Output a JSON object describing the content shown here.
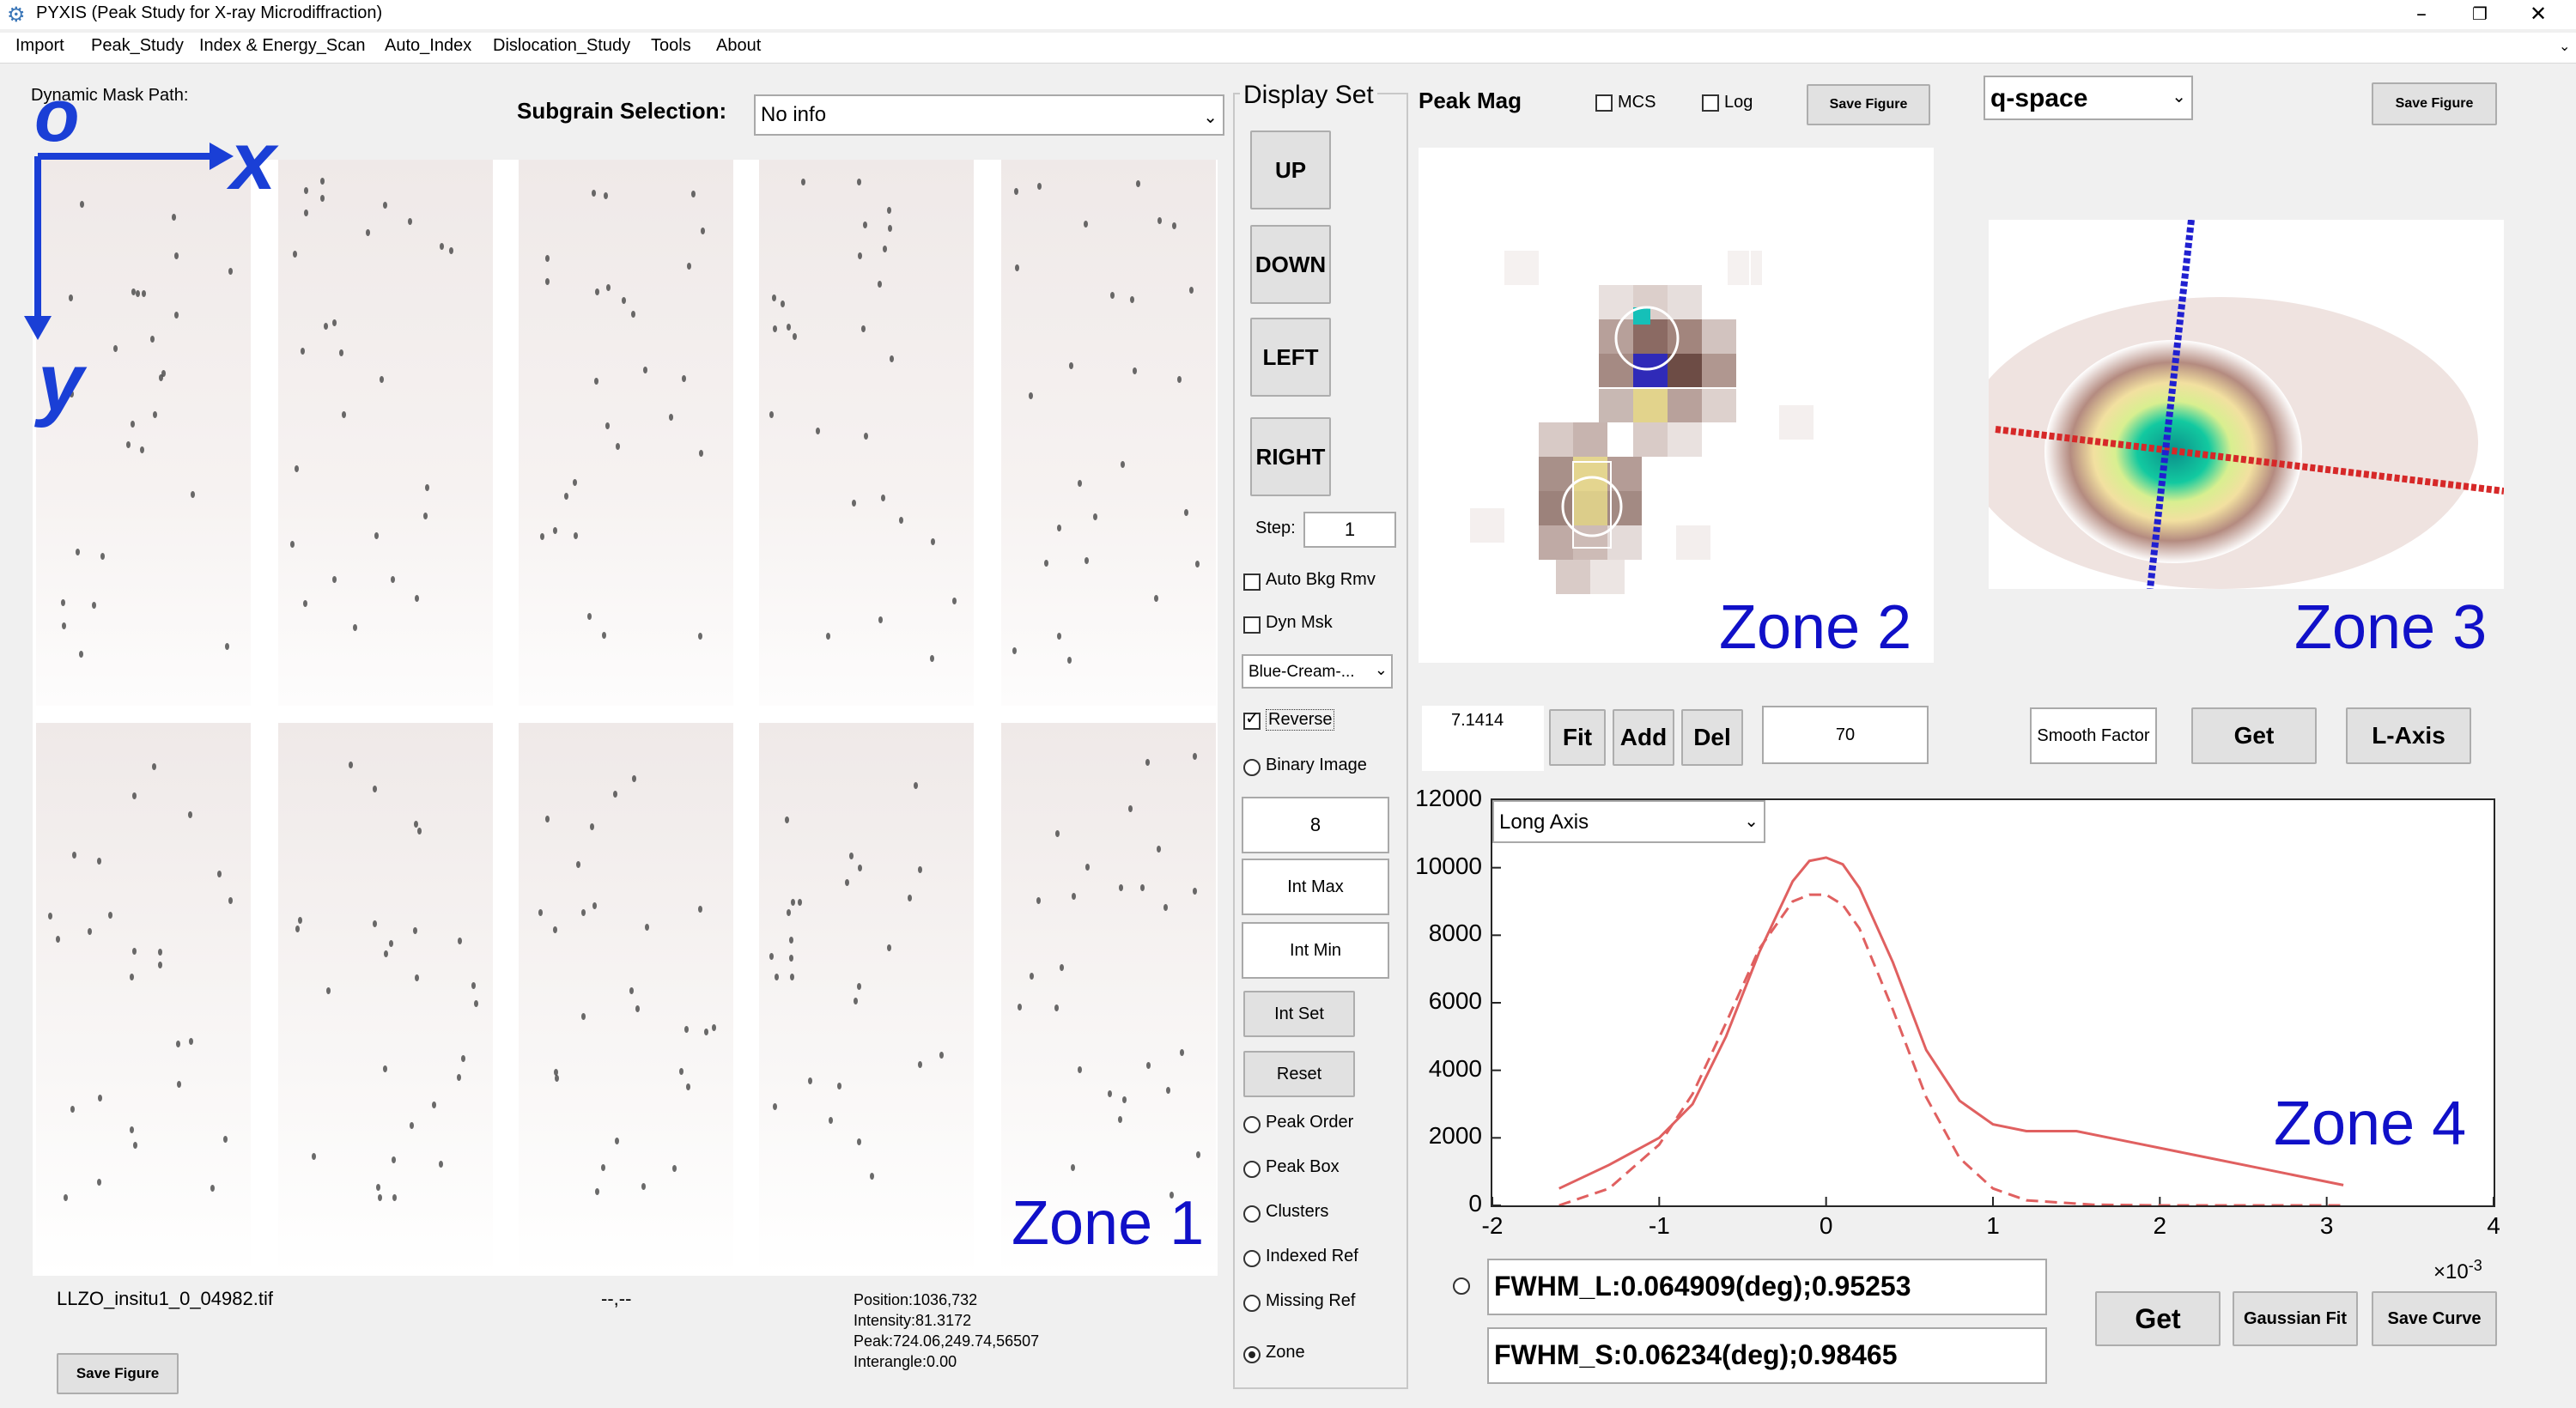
{
  "window": {
    "title": "PYXIS (Peak Study for X-ray Microdiffraction)",
    "app_icon": "gear-icon",
    "controls": [
      "–",
      "❐",
      "✕"
    ]
  },
  "menu": [
    "Import",
    "Peak_Study",
    "Index & Energy_Scan",
    "Auto_Index",
    "Dislocation_Study",
    "Tools",
    "About"
  ],
  "zone1": {
    "mask_path_label": "Dynamic Mask Path:",
    "subgrain_label": "Subgrain Selection:",
    "subgrain_value": "No info",
    "axis_origin": "o",
    "axis_x": "x",
    "axis_y": "y",
    "zone_label": "Zone 1",
    "filename": "LLZO_insitu1_0_04982.tif",
    "coords": "--,--",
    "position": "Position:1036,732",
    "intensity": "Intensity:81.3172",
    "peak": "Peak:724.06,249.74,56507",
    "interangle": "Interangle:0.00",
    "save_figure": "Save Figure"
  },
  "display_set": {
    "title": "Display Set",
    "up": "UP",
    "down": "DOWN",
    "left": "LEFT",
    "right": "RIGHT",
    "step_label": "Step:",
    "step_value": "1",
    "auto_bkg": {
      "label": "Auto Bkg Rmv",
      "checked": false
    },
    "dyn_msk": {
      "label": "Dyn Msk",
      "checked": false
    },
    "colormap": "Blue-Cream-...",
    "reverse": {
      "label": "Reverse",
      "checked": true
    },
    "binary_image": "Binary Image",
    "binary_value": "8",
    "int_max": "Int Max",
    "int_min": "Int Min",
    "int_set": "Int Set",
    "reset": "Reset",
    "radios": [
      {
        "label": "Peak Order",
        "selected": false
      },
      {
        "label": "Peak Box",
        "selected": false
      },
      {
        "label": "Clusters",
        "selected": false
      },
      {
        "label": "Indexed Ref",
        "selected": false
      },
      {
        "label": "Missing Ref",
        "selected": false
      },
      {
        "label": "Zone",
        "selected": true
      }
    ]
  },
  "zone2": {
    "title": "Peak Mag",
    "mcs": {
      "label": "MCS",
      "checked": false
    },
    "log": {
      "label": "Log",
      "checked": false
    },
    "save_figure": "Save Figure",
    "zone_label": "Zone 2",
    "value_readout": "7.1414",
    "fit": "Fit",
    "add": "Add",
    "del": "Del",
    "box_value": "70"
  },
  "zone3": {
    "space_select": "q-space",
    "save_figure": "Save Figure",
    "zone_label": "Zone 3",
    "smooth_factor": "Smooth Factor",
    "get": "Get",
    "l_axis": "L-Axis"
  },
  "zone4": {
    "axis_select": "Long Axis",
    "zone_label": "Zone 4",
    "fwhm_l": "FWHM_L:0.064909(deg);0.95253",
    "fwhm_s": "FWHM_S:0.06234(deg);0.98465",
    "get": "Get",
    "gaussian_fit": "Gaussian Fit",
    "save_curve": "Save Curve",
    "x_multiplier": "×10",
    "x_multiplier_exp": "-3"
  },
  "colors": {
    "zone_label": "#1010c8",
    "axis_arrow": "#1a3fd6",
    "curve": "#e06060",
    "q_long_axis": "#d62828",
    "q_short_axis": "#2020d0"
  },
  "chart_data": {
    "type": "line",
    "xlim": [
      -2,
      4
    ],
    "ylim": [
      0,
      12000
    ],
    "x_ticks": [
      -2,
      -1,
      0,
      1,
      2,
      3,
      4
    ],
    "y_ticks": [
      0,
      2000,
      4000,
      6000,
      8000,
      10000,
      12000
    ],
    "x_tick_labels": [
      "-2",
      "-1",
      "0",
      "1",
      "2",
      "3",
      "4"
    ],
    "y_tick_labels": [
      "0",
      "2000",
      "4000",
      "6000",
      "8000",
      "10000",
      "12000"
    ],
    "series": [
      {
        "style": "solid",
        "x": [
          -1.6,
          -1.3,
          -1.0,
          -0.8,
          -0.6,
          -0.4,
          -0.2,
          -0.1,
          0.0,
          0.1,
          0.2,
          0.4,
          0.6,
          0.8,
          1.0,
          1.2,
          1.5,
          1.8,
          2.2,
          2.6,
          3.1
        ],
        "y": [
          500,
          1200,
          2000,
          3000,
          5000,
          7500,
          9600,
          10200,
          10300,
          10100,
          9400,
          7200,
          4600,
          3100,
          2400,
          2200,
          2200,
          1900,
          1500,
          1100,
          600
        ]
      },
      {
        "style": "dashed",
        "x": [
          -1.6,
          -1.3,
          -1.0,
          -0.8,
          -0.6,
          -0.4,
          -0.2,
          -0.1,
          0.0,
          0.1,
          0.2,
          0.4,
          0.6,
          0.8,
          1.0,
          1.2,
          1.6,
          2.0,
          2.5,
          3.1
        ],
        "y": [
          0,
          500,
          1800,
          3300,
          5400,
          7600,
          9000,
          9200,
          9200,
          8900,
          8200,
          5800,
          3200,
          1400,
          500,
          150,
          20,
          0,
          0,
          0
        ]
      }
    ]
  }
}
